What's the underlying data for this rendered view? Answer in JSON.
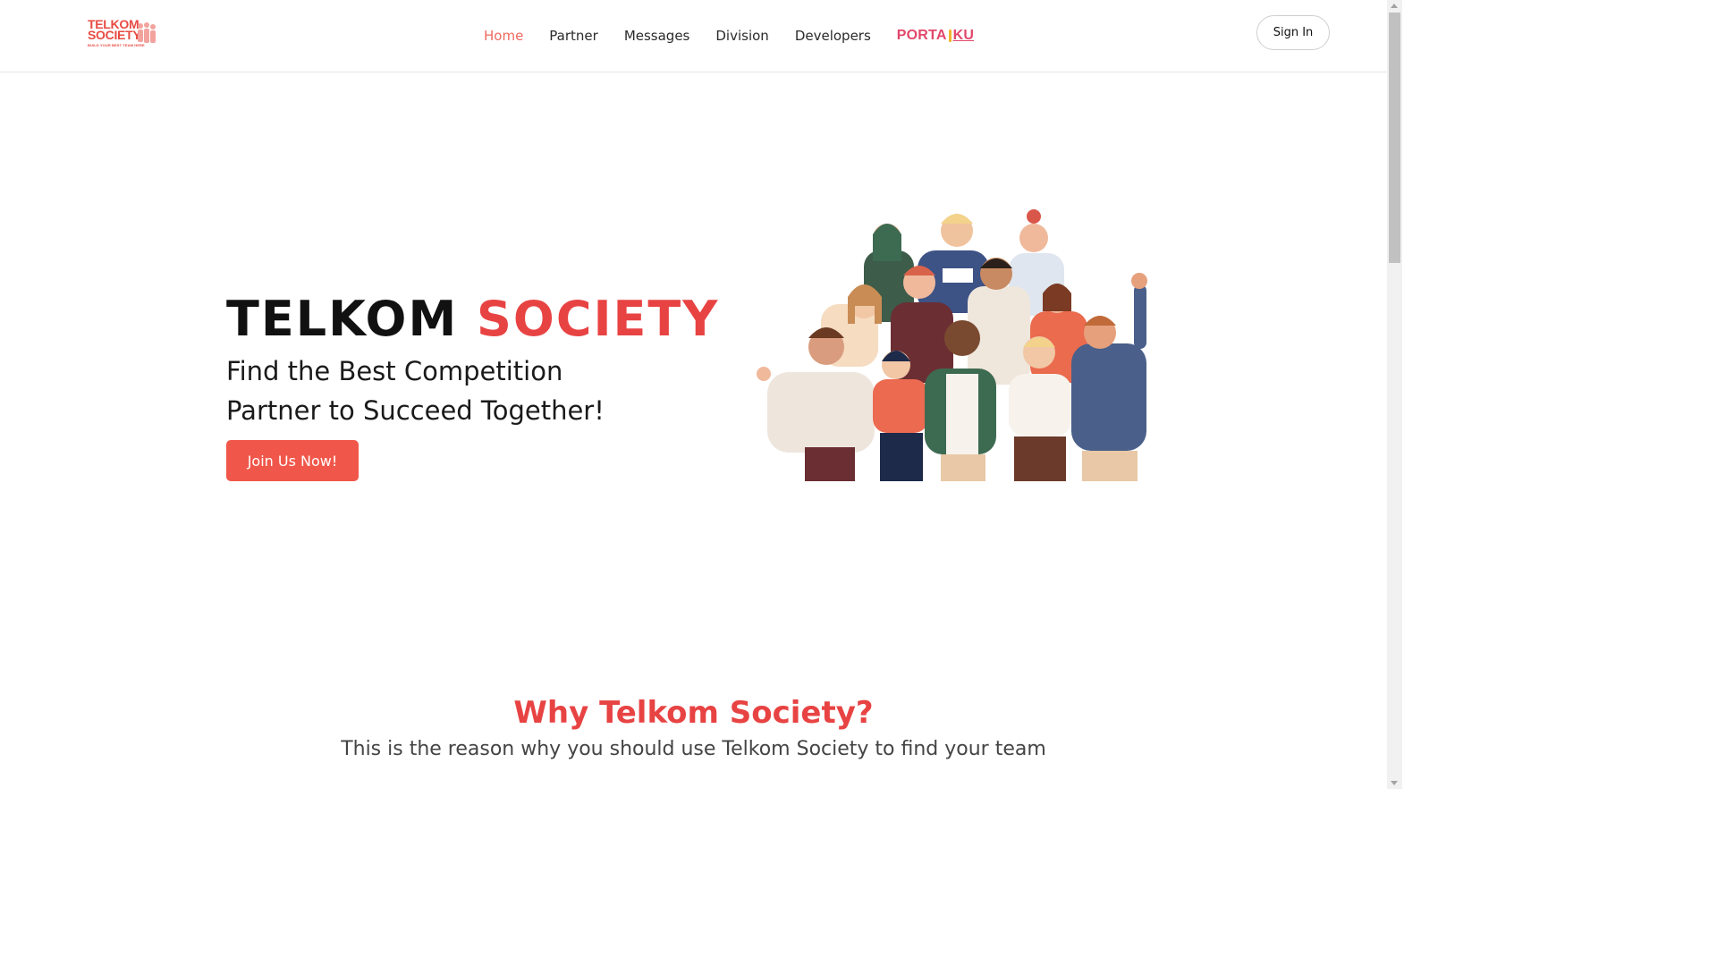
{
  "logo": {
    "line1": "TELKOM",
    "line2": "SOCIETY",
    "tagline": "BUILD YOUR BEST TEAM HERE"
  },
  "nav": {
    "items": [
      {
        "label": "Home",
        "active": true
      },
      {
        "label": "Partner",
        "active": false
      },
      {
        "label": "Messages",
        "active": false
      },
      {
        "label": "Division",
        "active": false
      },
      {
        "label": "Developers",
        "active": false
      }
    ],
    "portal": {
      "part1": "PORTA",
      "part2": "KU"
    }
  },
  "header": {
    "signin_label": "Sign In"
  },
  "hero": {
    "title_part1": "TELKOM",
    "title_part2": "SOCIETY",
    "subtitle_line1": "Find the Best Competition",
    "subtitle_line2": "Partner to Succeed Together!",
    "cta_label": "Join Us Now!"
  },
  "why": {
    "title": "Why Telkom Society?",
    "subtitle": "This is the reason why you should use Telkom Society to find your team"
  },
  "colors": {
    "accent": "#e84343",
    "button": "#f0574a",
    "nav_active": "#ef6a5f",
    "portal": "#e2486a"
  },
  "icons": {
    "logo_people": "people-group-icon",
    "hero_illustration": "crowd-illustration"
  }
}
